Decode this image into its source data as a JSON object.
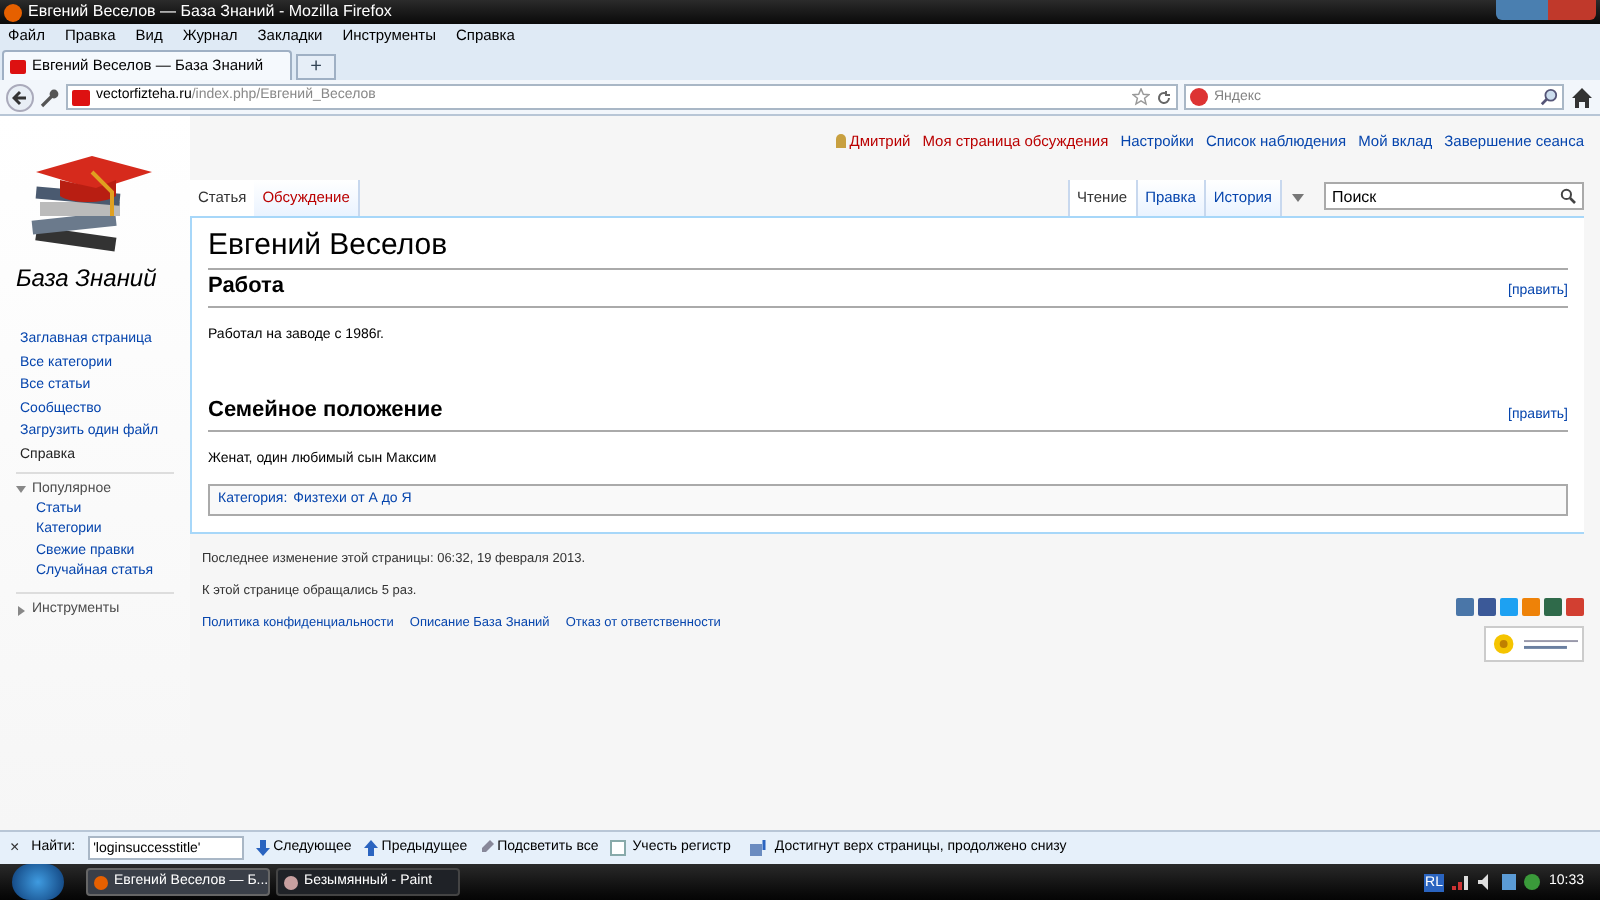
{
  "window": {
    "title": "Евгений Веселов — База Знаний - Mozilla Firefox"
  },
  "menu": [
    "Файл",
    "Правка",
    "Вид",
    "Журнал",
    "Закладки",
    "Инструменты",
    "Справка"
  ],
  "browser_tabs": [
    {
      "label": "Евгений Веселов — База Знаний",
      "selected": true
    }
  ],
  "new_tab": "+",
  "address": {
    "domain": "vectorfizteha.ru",
    "path": "/index.php/Евгений_Веселов"
  },
  "web_search": {
    "placeholder": "Яндекс"
  },
  "user_links": [
    {
      "label": "Дмитрий",
      "kind": "user"
    },
    {
      "label": "Моя страница обсуждения",
      "kind": "new"
    },
    {
      "label": "Настройки",
      "kind": "link"
    },
    {
      "label": "Список наблюдения",
      "kind": "link"
    },
    {
      "label": "Мой вклад",
      "kind": "link"
    },
    {
      "label": "Завершение сеанса",
      "kind": "link"
    }
  ],
  "page_tabs": [
    {
      "label": "Статья",
      "selected": true
    },
    {
      "label": "Обсуждение",
      "selected": false
    }
  ],
  "view_tabs": [
    {
      "label": "Чтение",
      "selected": true
    },
    {
      "label": "Правка",
      "selected": false
    },
    {
      "label": "История",
      "selected": false
    }
  ],
  "wiki_search": {
    "placeholder": "Поиск"
  },
  "logo_text": "База Знаний",
  "navigation": [
    {
      "label": "Заглавная страница",
      "visited": false
    },
    {
      "label": "Все категории",
      "visited": false
    },
    {
      "label": "Все статьи",
      "visited": false
    },
    {
      "label": "Сообщество",
      "visited": false
    },
    {
      "label": "Загрузить один файл",
      "visited": false
    },
    {
      "label": "Справка",
      "visited": true
    }
  ],
  "portlets": [
    {
      "label": "Популярное",
      "expanded": true,
      "items": [
        "Статьи",
        "Категории",
        "Свежие правки",
        "Случайная статья"
      ]
    },
    {
      "label": "Инструменты",
      "expanded": false
    }
  ],
  "article": {
    "title": "Евгений Веселов",
    "sections": [
      {
        "heading": "Работа",
        "edit": "[править]",
        "text": "Работал на заводе с 1986г."
      },
      {
        "heading": "Семейное положение",
        "edit": "[править]",
        "text": "Женат, один любимый сын Максим"
      }
    ],
    "category": {
      "label": "Категория:",
      "links": [
        "Физтехи от А до Я"
      ]
    }
  },
  "footer": {
    "lines": [
      "Последнее изменение этой страницы: 06:32, 19 февраля 2013.",
      "К этой странице обращались 5 раз."
    ],
    "links": [
      "Политика конфиденциальности",
      "Описание База Знаний",
      "Отказ от ответственности"
    ]
  },
  "find_bar": {
    "close": "×",
    "label": "Найти:",
    "value": "'loginsuccesstitle'",
    "next": "Следующее",
    "previous": "Предыдущее",
    "highlight": "Подсветить все",
    "match_case": {
      "label": "Учесть регистр",
      "checked": false
    },
    "status": "Достигнут верх страницы, продолжено снизу"
  },
  "taskbar": {
    "items": [
      {
        "label": "Евгений Веселов — Б...",
        "selected": true
      },
      {
        "label": "Безымянный - Paint",
        "selected": false
      }
    ],
    "language": "RL",
    "time": "10:33"
  }
}
